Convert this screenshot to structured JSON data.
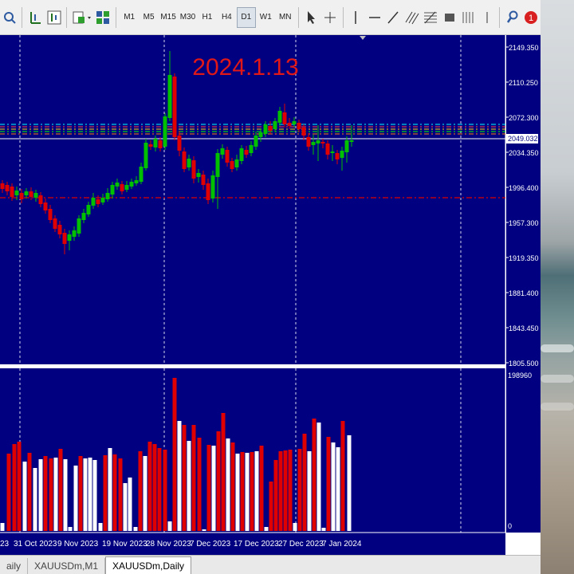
{
  "toolbar": {
    "timeframes": [
      "M1",
      "M5",
      "M15",
      "M30",
      "H1",
      "H4",
      "D1",
      "W1",
      "MN"
    ],
    "active_timeframe": "D1"
  },
  "chart": {
    "annotation": "2024.1.13",
    "price_scale": [
      "2149.350",
      "2110.250",
      "2072.300",
      "2034.350",
      "1996.400",
      "1957.300",
      "1919.350",
      "1881.400",
      "1843.450",
      "1805.500"
    ],
    "current_price": "2049.032",
    "volume_scale_top": "198960",
    "volume_scale_bottom": "0",
    "date_labels": [
      "23",
      "31 Oct 2023",
      "9 Nov 2023",
      "19 Nov 2023",
      "28 Nov 2023",
      "7 Dec 2023",
      "17 Dec 2023",
      "27 Dec 2023",
      "7 Jan 2024"
    ],
    "colors": {
      "background": "#000080",
      "bull": "#00c000",
      "bear": "#e00000",
      "grid": "#ffffff",
      "vol_up": "#ffffff",
      "vol_down": "#e00000"
    }
  },
  "tabs": [
    {
      "label": "aily",
      "active": false
    },
    {
      "label": "XAUUSDm,M1",
      "active": false
    },
    {
      "label": "XAUUSDm,Daily",
      "active": true
    }
  ]
}
